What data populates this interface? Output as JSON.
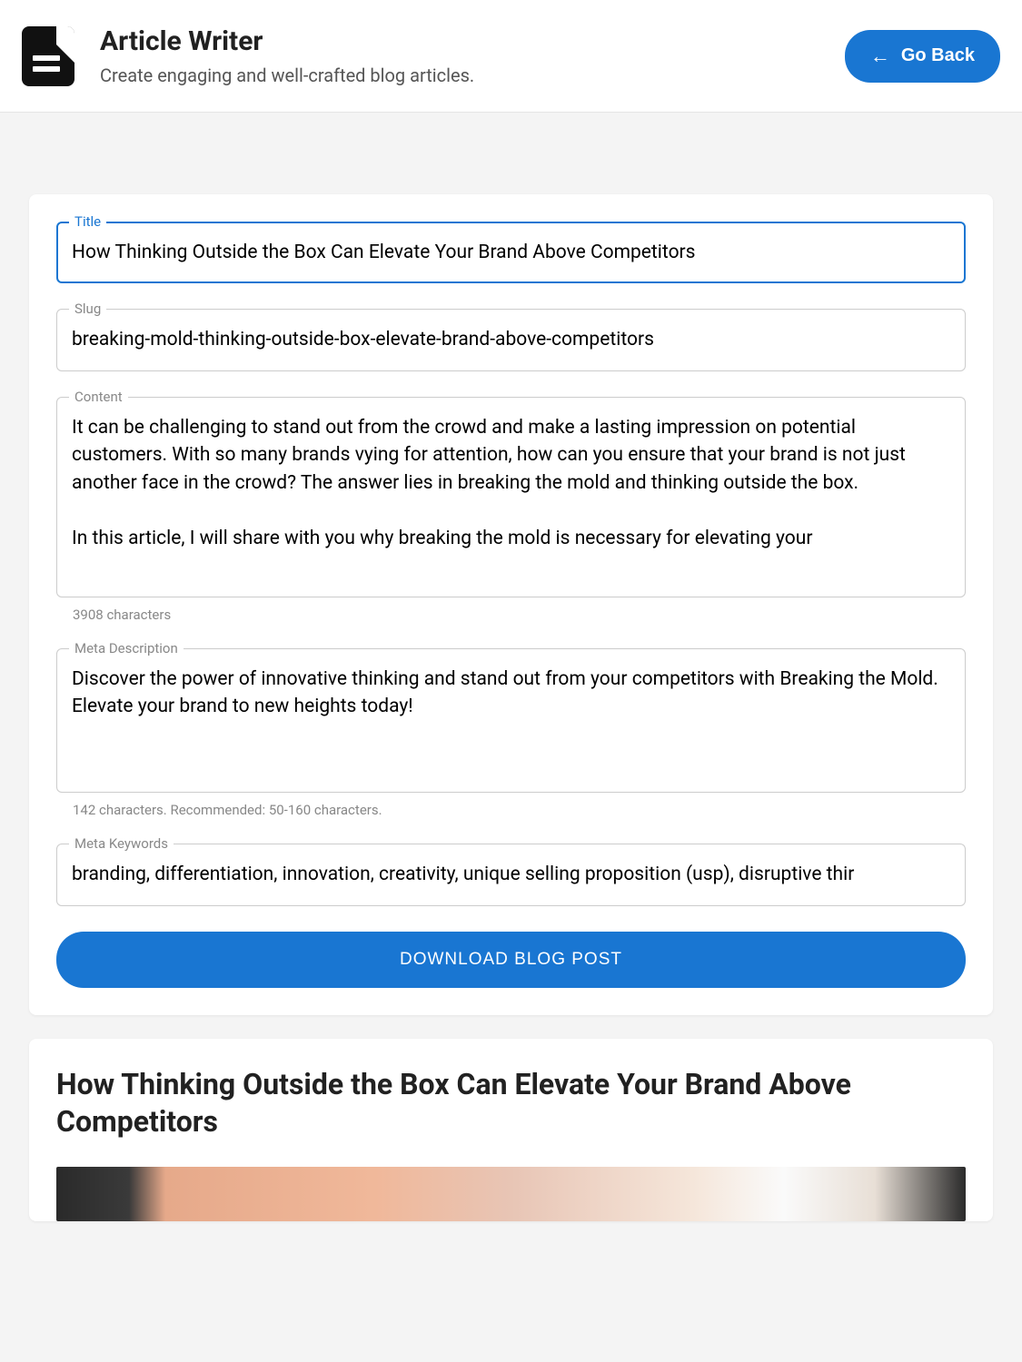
{
  "header": {
    "title": "Article Writer",
    "subtitle": "Create engaging and well-crafted blog articles.",
    "go_back_label": "Go Back"
  },
  "form": {
    "title": {
      "label": "Title",
      "value": "How Thinking Outside the Box Can Elevate Your Brand Above Competitors"
    },
    "slug": {
      "label": "Slug",
      "value": "breaking-mold-thinking-outside-box-elevate-brand-above-competitors"
    },
    "content": {
      "label": "Content",
      "value": "It can be challenging to stand out from the crowd and make a lasting impression on potential customers. With so many brands vying for attention, how can you ensure that your brand is not just another face in the crowd? The answer lies in breaking the mold and thinking outside the box.\n\nIn this article, I will share with you why breaking the mold is necessary for elevating your",
      "helper": "3908 characters"
    },
    "meta_description": {
      "label": "Meta Description",
      "value": "Discover the power of innovative thinking and stand out from your competitors with Breaking the Mold. Elevate your brand to new heights today!",
      "helper": "142 characters. Recommended: 50-160 characters."
    },
    "meta_keywords": {
      "label": "Meta Keywords",
      "value": "branding, differentiation, innovation, creativity, unique selling proposition (usp), disruptive thir"
    },
    "download_label": "DOWNLOAD BLOG POST"
  },
  "preview": {
    "title": "How Thinking Outside the Box Can Elevate Your Brand Above Competitors"
  },
  "colors": {
    "primary": "#1976d2"
  }
}
